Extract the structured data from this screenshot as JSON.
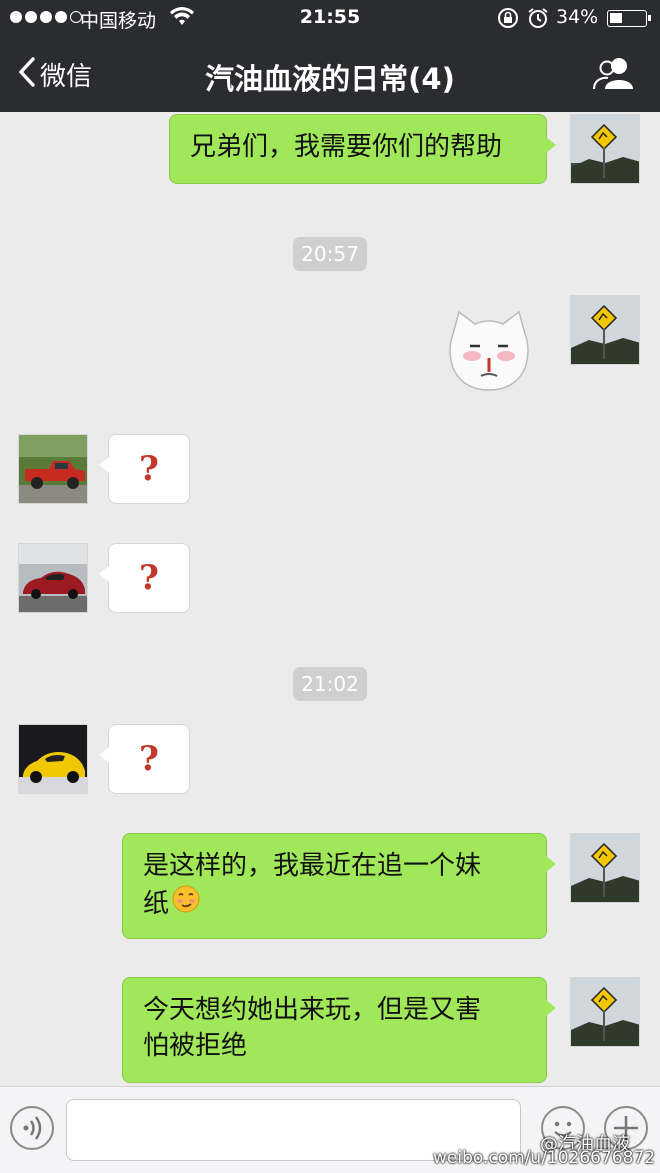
{
  "status_bar": {
    "carrier": "中国移动",
    "time": "21:55",
    "battery_percent": "34%",
    "battery_level": 0.34
  },
  "nav": {
    "back_label": "微信",
    "title": "汽油血液的日常(4)"
  },
  "messages": {
    "m1": {
      "side": "right",
      "text": "兄弟们，我需要你们的帮助"
    },
    "t1": "20:57",
    "m2": {
      "side": "right",
      "type": "sticker",
      "sticker": "blushing-cat-face-sticker"
    },
    "m3": {
      "side": "left",
      "text": "?",
      "avatar": "red-pickup-truck-avatar"
    },
    "m4": {
      "side": "left",
      "text": "?",
      "avatar": "red-sedan-avatar"
    },
    "t2": "21:02",
    "m5": {
      "side": "left",
      "text": "?",
      "avatar": "yellow-sports-car-avatar"
    },
    "m6": {
      "side": "right",
      "text_line1": "是这样的，我最近在追一个妹",
      "text_line2": "纸",
      "emoji": "smirk-emoji"
    },
    "m7": {
      "side": "right",
      "text_line1": "今天想约她出来玩，但是又害",
      "text_line2": "怕被拒绝"
    }
  },
  "input_bar": {
    "placeholder": ""
  },
  "watermark": {
    "line1": "@汽油血液",
    "line2": "weibo.com/u/1026676872"
  },
  "colors": {
    "nav_bg": "#2b2c30",
    "chat_bg": "#ebebeb",
    "bubble_right": "#a0e75a",
    "bubble_left": "#ffffff",
    "question_mark": "#c0392b"
  }
}
